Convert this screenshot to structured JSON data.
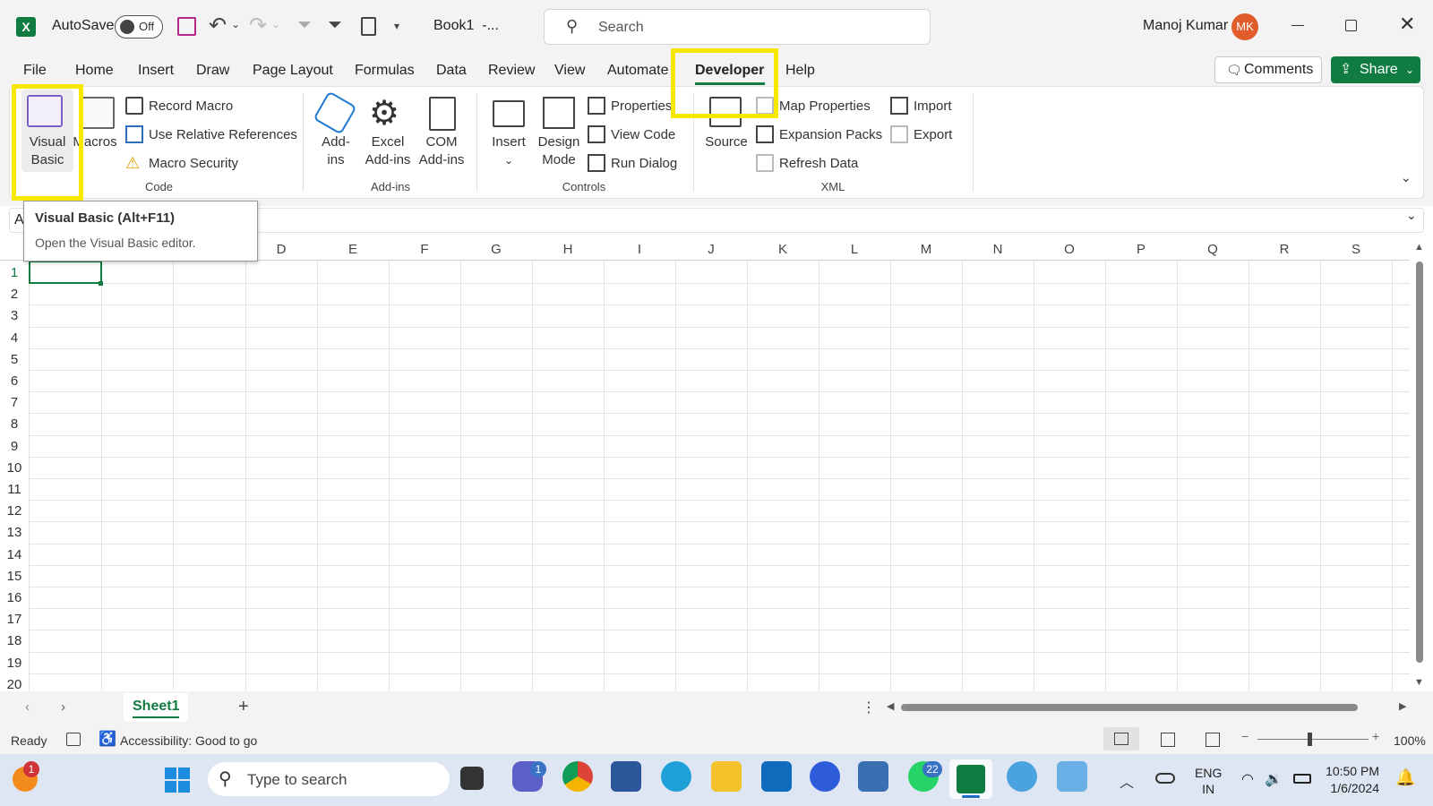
{
  "titlebar": {
    "autosave_label": "AutoSave",
    "autosave_state": "Off",
    "doc_title": "Book1  -...",
    "search_placeholder": "Search",
    "user_name": "Manoj Kumar",
    "user_initials": "MK"
  },
  "tabs": [
    "File",
    "Home",
    "Insert",
    "Draw",
    "Page Layout",
    "Formulas",
    "Data",
    "Review",
    "View",
    "Automate",
    "Developer",
    "Help"
  ],
  "active_tab": "Developer",
  "comments_label": "Comments",
  "share_label": "Share",
  "ribbon": {
    "code": {
      "visual_basic": [
        "Visual",
        "Basic"
      ],
      "macros": "Macros",
      "record_macro": "Record Macro",
      "use_relative": "Use Relative References",
      "macro_security": "Macro Security",
      "label": "Code"
    },
    "addins": {
      "addins": [
        "Add-",
        "ins"
      ],
      "excel_addins": [
        "Excel",
        "Add-ins"
      ],
      "com_addins": [
        "COM",
        "Add-ins"
      ],
      "label": "Add-ins"
    },
    "controls": {
      "insert": "Insert",
      "design_mode": [
        "Design",
        "Mode"
      ],
      "properties": "Properties",
      "view_code": "View Code",
      "run_dialog": "Run Dialog",
      "label": "Controls"
    },
    "xml": {
      "source": "Source",
      "map_properties": "Map Properties",
      "expansion_packs": "Expansion Packs",
      "refresh_data": "Refresh Data",
      "import": "Import",
      "export": "Export",
      "label": "XML"
    }
  },
  "tooltip": {
    "title": "Visual Basic (Alt+F11)",
    "desc": "Open the Visual Basic editor."
  },
  "namebox_partial": "A",
  "columns": [
    "D",
    "E",
    "F",
    "G",
    "H",
    "I",
    "J",
    "K",
    "L",
    "M",
    "N",
    "O",
    "P",
    "Q",
    "R",
    "S"
  ],
  "rows": [
    "1",
    "2",
    "3",
    "4",
    "5",
    "6",
    "7",
    "8",
    "9",
    "10",
    "11",
    "12",
    "13",
    "14",
    "15",
    "16",
    "17",
    "18",
    "19",
    "20"
  ],
  "sheet_tab": "Sheet1",
  "status": {
    "ready": "Ready",
    "accessibility": "Accessibility: Good to go",
    "zoom": "100%"
  },
  "taskbar": {
    "search_placeholder": "Type to search",
    "notif_badge": "1",
    "teams_badge": "1",
    "whatsapp_badge": "22",
    "lang_line1": "ENG",
    "lang_line2": "IN",
    "time": "10:50 PM",
    "date": "1/6/2024"
  },
  "colors": {
    "excel_green": "#107c41",
    "highlight_yellow": "#f6e800",
    "avatar": "#e05c2a"
  }
}
